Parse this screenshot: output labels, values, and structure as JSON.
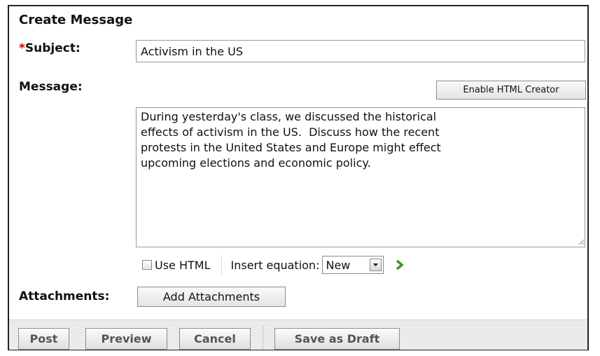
{
  "form": {
    "title": "Create Message",
    "required_marker": "*",
    "subject_label": "Subject:",
    "subject_value": "Activism in the US",
    "message_label": "Message:",
    "enable_html_creator_label": "Enable HTML Creator",
    "message_body": "During yesterday's class, we discussed the historical\neffects of activism in the US.  Discuss how the recent\nprotests in the United States and Europe might effect\nupcoming elections and economic policy.",
    "use_html_label": "Use HTML",
    "use_html_checked": false,
    "insert_equation_label": "Insert equation:",
    "equation_select_value": "New",
    "attachments_label": "Attachments:",
    "add_attachments_label": "Add Attachments"
  },
  "footer": {
    "post_label": "Post",
    "preview_label": "Preview",
    "cancel_label": "Cancel",
    "save_draft_label": "Save as Draft"
  },
  "icons": {
    "go": "green-chevron-right-icon",
    "select_arrow": "dropdown-arrow-icon",
    "resize": "resize-grip-icon"
  },
  "colors": {
    "required": "#cc0000",
    "go_icon": "#3a9a1a",
    "footer_button_text": "#555555"
  }
}
